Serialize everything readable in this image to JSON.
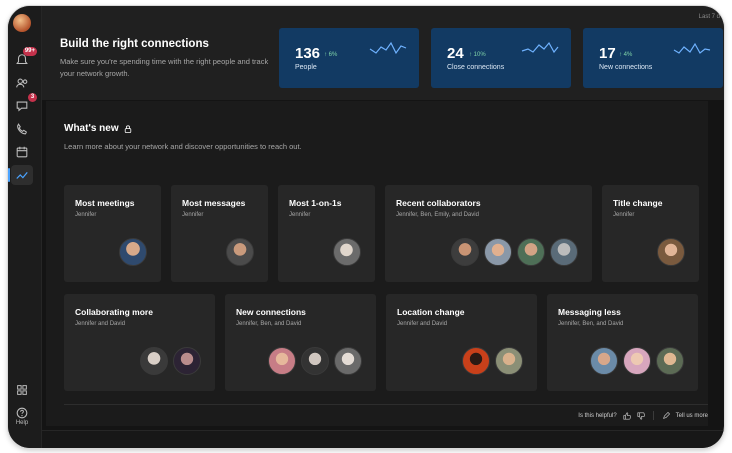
{
  "rail": {
    "items": [
      {
        "name": "activity",
        "badge": "99+"
      },
      {
        "name": "teams",
        "badge": ""
      },
      {
        "name": "chat",
        "badge": "3"
      },
      {
        "name": "calls",
        "badge": ""
      },
      {
        "name": "calendar",
        "badge": ""
      },
      {
        "name": "insights",
        "badge": "",
        "active": true
      }
    ],
    "help_label": "Help"
  },
  "banner": {
    "title": "Build the right connections",
    "description": "Make sure you're spending time with the right people and track your network growth.",
    "corner_note": "Last 7 d",
    "stats": [
      {
        "value": "136",
        "delta": "↑ 6%",
        "label": "People"
      },
      {
        "value": "24",
        "delta": "↑ 10%",
        "label": "Close connections"
      },
      {
        "value": "17",
        "delta": "↑ 4%",
        "label": "New connections"
      }
    ]
  },
  "whats_new": {
    "title": "What's new",
    "subtitle": "Learn more about your network and discover opportunities to reach out.",
    "cards": [
      {
        "title": "Most meetings",
        "people": "Jennifer"
      },
      {
        "title": "Most messages",
        "people": "Jennifer"
      },
      {
        "title": "Most 1-on-1s",
        "people": "Jennifer"
      },
      {
        "title": "Recent collaborators",
        "people": "Jennifer, Ben, Emily, and David"
      },
      {
        "title": "Title change",
        "people": "Jennifer"
      },
      {
        "title": "Collaborating more",
        "people": "Jennifer and David"
      },
      {
        "title": "New connections",
        "people": "Jennifer, Ben, and David"
      },
      {
        "title": "Location change",
        "people": "Jennifer and David"
      },
      {
        "title": "Messaging less",
        "people": "Jennifer, Ben, and David"
      }
    ]
  },
  "feedback": {
    "question": "Is this helpful?",
    "tell_more": "Tell us more"
  },
  "colors": {
    "accent": "#4aa3ff",
    "stat_tile": "#123a63",
    "badge": "#c4314b"
  }
}
